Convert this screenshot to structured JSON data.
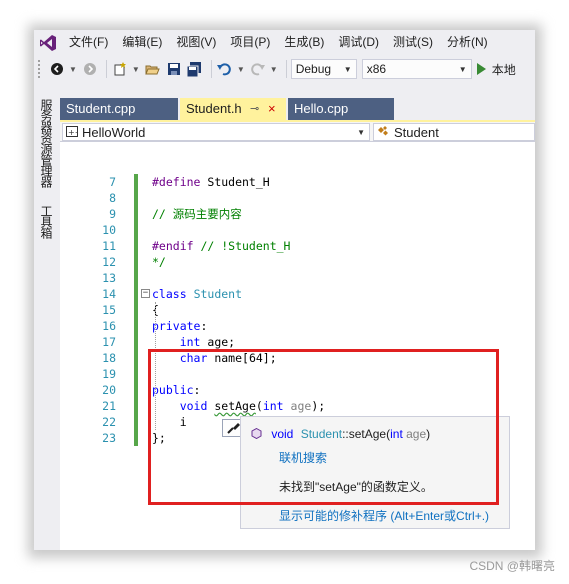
{
  "menu": [
    "文件(F)",
    "编辑(E)",
    "视图(V)",
    "项目(P)",
    "生成(B)",
    "调试(D)",
    "测试(S)",
    "分析(N)"
  ],
  "toolbar": {
    "configuration": "Debug",
    "platform": "x86",
    "run_label": "本地"
  },
  "side_panel": {
    "solution_explorer": "服务器资源管理器",
    "toolbox": "工具箱"
  },
  "tabs": [
    {
      "label": "Student.cpp",
      "active": false
    },
    {
      "label": "Student.h",
      "active": true,
      "pin": "⊸",
      "close": "×"
    },
    {
      "label": "Hello.cpp",
      "active": false
    }
  ],
  "navbar": {
    "project": "HelloWorld",
    "scope": "Student"
  },
  "code_lines": [
    {
      "n": "7",
      "text": "#define Student_H"
    },
    {
      "n": "8",
      "text": ""
    },
    {
      "n": "9",
      "text": "// 源码主要内容"
    },
    {
      "n": "10",
      "text": ""
    },
    {
      "n": "11",
      "text": "#endif // !Student_H"
    },
    {
      "n": "12",
      "text": "*/"
    },
    {
      "n": "13",
      "text": ""
    },
    {
      "n": "14",
      "text": "class Student"
    },
    {
      "n": "15",
      "text": "{"
    },
    {
      "n": "16",
      "text": "private:"
    },
    {
      "n": "17",
      "text": "    int age;"
    },
    {
      "n": "18",
      "text": "    char name[64];"
    },
    {
      "n": "19",
      "text": ""
    },
    {
      "n": "20",
      "text": "public:"
    },
    {
      "n": "21",
      "text": "    void setAge(int age);"
    },
    {
      "n": "22",
      "text": "    i"
    },
    {
      "n": "23",
      "text": "};"
    }
  ],
  "quickinfo": {
    "signature_void": "void",
    "signature_class": "Student",
    "signature_sep": "::",
    "signature_method": "setAge",
    "signature_params_open": "(",
    "signature_params_type": "int",
    "signature_params_name": " age",
    "signature_params_close": ")",
    "online_search": "联机搜索",
    "message": "未找到\"setAge\"的函数定义。",
    "fix_link": "显示可能的修补程序",
    "fix_shortcut": " (Alt+Enter或Ctrl+.)"
  },
  "watermark": "CSDN @韩曙亮",
  "colors": {
    "keyword": "#0000ff",
    "type_name": "#2b91af",
    "comment": "#008000",
    "preprocessor": "#6f008a",
    "highlight_border": "#e02020"
  }
}
